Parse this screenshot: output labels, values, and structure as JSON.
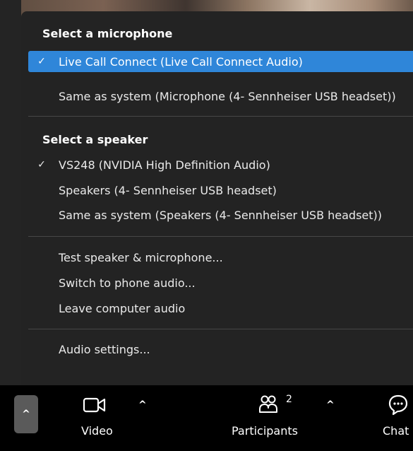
{
  "menu": {
    "microphone_section": {
      "title": "Select a microphone",
      "items": [
        {
          "label": "Live Call Connect (Live Call Connect Audio)",
          "check": "✓",
          "selected": true
        },
        {
          "label": "Same as system (Microphone (4- Sennheiser USB headset))",
          "check": "",
          "selected": false
        }
      ]
    },
    "speaker_section": {
      "title": "Select a speaker",
      "items": [
        {
          "label": "VS248 (NVIDIA High Definition Audio)",
          "check": "✓"
        },
        {
          "label": "Speakers (4- Sennheiser USB headset)",
          "check": ""
        },
        {
          "label": "Same as system (Speakers (4- Sennheiser USB headset))",
          "check": ""
        }
      ]
    },
    "actions": [
      {
        "label": "Test speaker & microphone..."
      },
      {
        "label": "Switch to phone audio..."
      },
      {
        "label": "Leave computer audio"
      }
    ],
    "settings": {
      "label": "Audio settings..."
    }
  },
  "toolbar": {
    "video": {
      "label": "Video",
      "icon": "video-camera-icon"
    },
    "participants": {
      "label": "Participants",
      "count": "2",
      "icon": "participants-icon"
    },
    "chat": {
      "label": "Chat",
      "icon": "chat-bubble-icon"
    }
  },
  "colors": {
    "menu_bg": "#232323",
    "selected_bg": "#2f86d9",
    "toolbar_bg": "#000000",
    "divider": "#474747"
  }
}
